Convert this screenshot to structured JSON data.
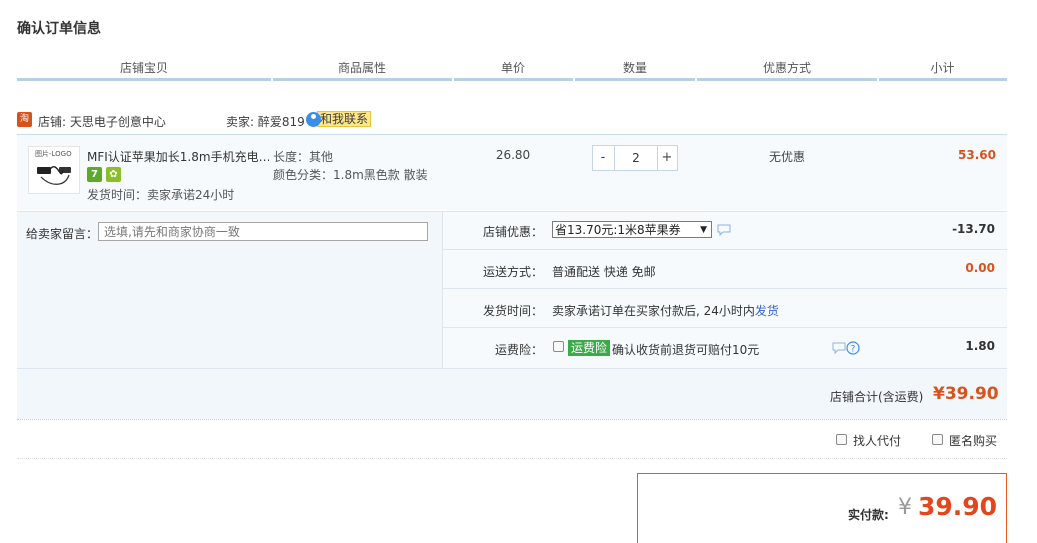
{
  "page_title": "确认订单信息",
  "columns": [
    "店铺宝贝",
    "商品属性",
    "单价",
    "数量",
    "优惠方式",
    "小计"
  ],
  "shop": {
    "icon_label": "淘",
    "label": "店铺: 天思电子创意中心",
    "seller": "卖家: 醉爱819",
    "contact_label": "和我联系"
  },
  "item": {
    "thumb_text": "图片-LOGO",
    "name": "MFI认证苹果加长1.8m手机充电…",
    "badges": [
      "7",
      "✿"
    ],
    "ship_time": "发货时间：卖家承诺24小时",
    "attr_length": "长度：其他",
    "attr_color": "颜色分类：1.8m黑色款 散装",
    "unit_price": "26.80",
    "qty_minus": "-",
    "qty": "2",
    "qty_plus": "+",
    "discount": "无优惠",
    "subtotal": "53.60"
  },
  "message": {
    "label": "给卖家留言：",
    "placeholder": "选填,请先和商家协商一致"
  },
  "shop_discount": {
    "label": "店铺优惠：",
    "selected": "省13.70元:1米8苹果券",
    "amount": "-13.70"
  },
  "shipping": {
    "label": "运送方式：",
    "value": "普通配送 快递 免邮",
    "amount": "0.00"
  },
  "delivery": {
    "label": "发货时间：",
    "value": "卖家承诺订单在买家付款后, 24小时内",
    "link": "发货"
  },
  "insurance": {
    "label": "运费险：",
    "tag": "运费险",
    "desc": "确认收货前退货可赔付10元",
    "amount": "1.80"
  },
  "shop_total": {
    "label": "店铺合计(含运费)",
    "value": "¥39.90"
  },
  "options": {
    "proxy_pay": "找人代付",
    "anonymous": "匿名购买"
  },
  "pay": {
    "label": "实付款:",
    "currency": "¥",
    "value": "39.90"
  },
  "colors": {
    "accent": "#d9521b",
    "header_line": "#b9cfe8",
    "row_bg": "#f2f7fc",
    "link": "#3366cc",
    "insurance_green": "#3bab4a"
  }
}
